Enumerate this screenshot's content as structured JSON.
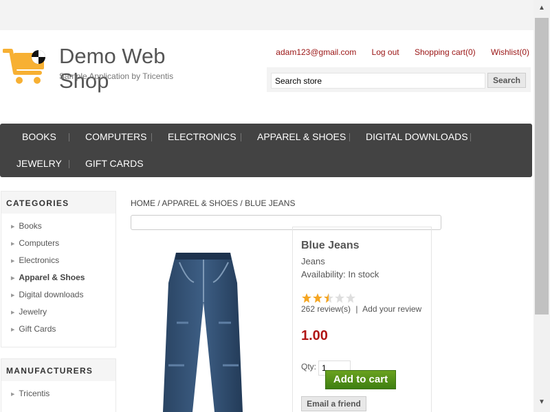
{
  "header": {
    "logo": {
      "title": "Demo Web Shop",
      "subtitle": "Sample Application by Tricentis",
      "icon": "shopping-cart-icon",
      "colors": {
        "cart": "#f7b033",
        "wheel": "#f7b033",
        "badge": "#111111"
      }
    },
    "links": {
      "account": "adam123@gmail.com",
      "logout": "Log out",
      "shopping_cart": "Shopping cart(0)",
      "wishlist": "Wishlist(0)"
    },
    "search": {
      "value": "Search store",
      "button_label": "Search"
    }
  },
  "navigation": {
    "items": [
      {
        "label": "BOOKS"
      },
      {
        "label": "COMPUTERS"
      },
      {
        "label": "ELECTRONICS"
      },
      {
        "label": "APPAREL & SHOES"
      },
      {
        "label": "DIGITAL DOWNLOADS"
      },
      {
        "label": "JEWELRY"
      },
      {
        "label": "GIFT CARDS"
      }
    ],
    "background_color": "#434343"
  },
  "sidebar": {
    "categories": {
      "title": "CATEGORIES",
      "items": [
        {
          "label": "Books",
          "active": false
        },
        {
          "label": "Computers",
          "active": false
        },
        {
          "label": "Electronics",
          "active": false
        },
        {
          "label": "Apparel & Shoes",
          "active": true
        },
        {
          "label": "Digital downloads",
          "active": false
        },
        {
          "label": "Jewelry",
          "active": false
        },
        {
          "label": "Gift Cards",
          "active": false
        }
      ]
    },
    "manufacturers": {
      "title": "MANUFACTURERS",
      "items": [
        {
          "label": "Tricentis"
        }
      ]
    }
  },
  "breadcrumb": {
    "items": [
      "HOME",
      "APPAREL & SHOES",
      "BLUE JEANS"
    ],
    "separator": "/"
  },
  "product": {
    "name": "Blue Jeans",
    "manufacturer": "Jeans",
    "availability": "Availability: In stock",
    "rating": 2.5,
    "reviews_text": "262 review(s)",
    "review_separator": "|",
    "add_review_text": "Add your review",
    "price": "1.00",
    "quantity_label": "Qty:",
    "quantity_value": "1",
    "add_to_cart_label": "Add to cart",
    "email_friend_label": "Email a friend",
    "image": "blue-jeans-image",
    "colors": {
      "price": "#b01515",
      "add_to_cart": "#4a8d15"
    }
  }
}
